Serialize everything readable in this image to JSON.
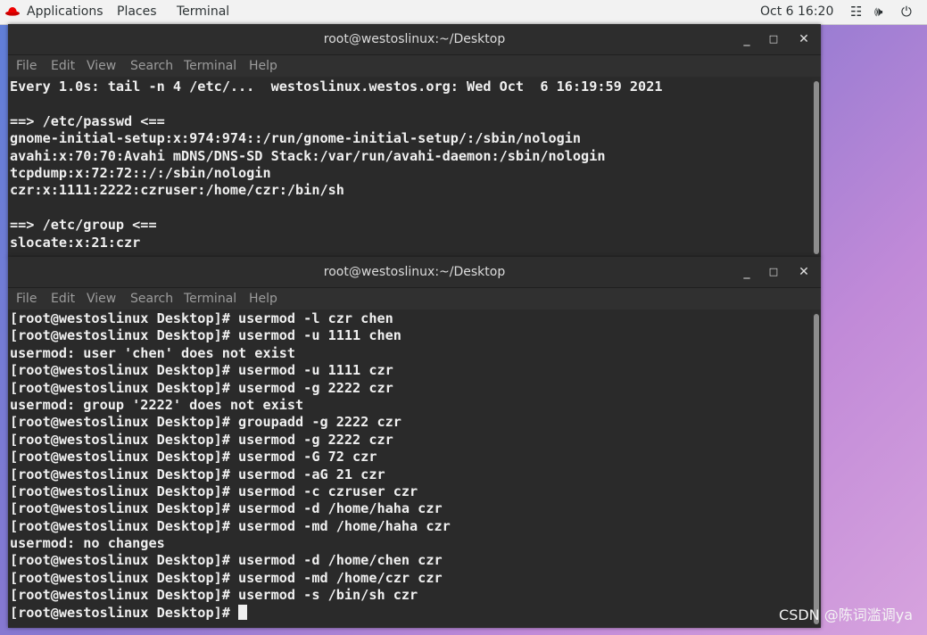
{
  "topbar": {
    "applications": "Applications",
    "places": "Places",
    "terminal": "Terminal",
    "datetime": "Oct 6 16:20",
    "network_icon": "network-icon",
    "volume_icon": "volume-icon",
    "power_icon": "power-icon"
  },
  "window1": {
    "title": "root@westoslinux:~/Desktop",
    "menu": [
      "File",
      "Edit",
      "View",
      "Search",
      "Terminal",
      "Help"
    ],
    "lines": [
      "Every 1.0s: tail -n 4 /etc/...  westoslinux.westos.org: Wed Oct  6 16:19:59 2021",
      "",
      "==> /etc/passwd <==",
      "gnome-initial-setup:x:974:974::/run/gnome-initial-setup/:/sbin/nologin",
      "avahi:x:70:70:Avahi mDNS/DNS-SD Stack:/var/run/avahi-daemon:/sbin/nologin",
      "tcpdump:x:72:72::/:/sbin/nologin",
      "czr:x:1111:2222:czruser:/home/czr:/bin/sh",
      "",
      "==> /etc/group <==",
      "slocate:x:21:czr"
    ]
  },
  "window2": {
    "title": "root@westoslinux:~/Desktop",
    "menu": [
      "File",
      "Edit",
      "View",
      "Search",
      "Terminal",
      "Help"
    ],
    "lines": [
      "[root@westoslinux Desktop]# usermod -l czr chen",
      "[root@westoslinux Desktop]# usermod -u 1111 chen",
      "usermod: user 'chen' does not exist",
      "[root@westoslinux Desktop]# usermod -u 1111 czr",
      "[root@westoslinux Desktop]# usermod -g 2222 czr",
      "usermod: group '2222' does not exist",
      "[root@westoslinux Desktop]# groupadd -g 2222 czr",
      "[root@westoslinux Desktop]# usermod -g 2222 czr",
      "[root@westoslinux Desktop]# usermod -G 72 czr",
      "[root@westoslinux Desktop]# usermod -aG 21 czr",
      "[root@westoslinux Desktop]# usermod -c czruser czr",
      "[root@westoslinux Desktop]# usermod -d /home/haha czr",
      "[root@westoslinux Desktop]# usermod -md /home/haha czr",
      "usermod: no changes",
      "[root@westoslinux Desktop]# usermod -d /home/chen czr",
      "[root@westoslinux Desktop]# usermod -md /home/czr czr",
      "[root@westoslinux Desktop]# usermod -s /bin/sh czr",
      "[root@westoslinux Desktop]# "
    ]
  },
  "watermark": "CSDN @陈词滥调ya"
}
